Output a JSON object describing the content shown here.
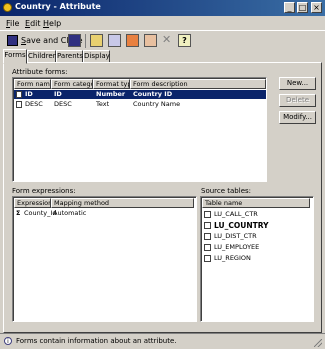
{
  "window": {
    "title": "Country - Attribute",
    "controls": [
      "_",
      "□",
      "×"
    ]
  },
  "menu": [
    {
      "label": "File",
      "underline": "F",
      "rest": "ile"
    },
    {
      "label": "Edit",
      "underline": "E",
      "rest": "dit"
    },
    {
      "label": "Help",
      "underline": "H",
      "rest": "elp"
    }
  ],
  "toolbar": {
    "save_close_u": "S",
    "save_close_rest": "ave and Close"
  },
  "tabs": [
    "Forms",
    "Children",
    "Parents",
    "Display"
  ],
  "attribute_forms": {
    "label": "Attribute forms:",
    "columns": [
      "Form name",
      "Form category",
      "Format type",
      "Form description"
    ],
    "rows": [
      {
        "name": "ID",
        "category": "ID",
        "format": "Number",
        "description": "Country ID"
      },
      {
        "name": "DESC",
        "category": "DESC",
        "format": "Text",
        "description": "Country Name"
      }
    ]
  },
  "buttons": {
    "new": "New...",
    "delete": "Delete",
    "modify": "Modify..."
  },
  "form_expressions": {
    "label": "Form expressions:",
    "columns": [
      "Expression",
      "Mapping method"
    ],
    "rows": [
      {
        "expression": "County_Id",
        "mapping": "Automatic"
      }
    ]
  },
  "source_tables": {
    "label": "Source tables:",
    "column": "Table name",
    "rows": [
      "LU_CALL_CTR",
      "LU_COUNTRY",
      "LU_DIST_CTR",
      "LU_EMPLOYEE",
      "LU_REGION"
    ]
  },
  "status": {
    "text": "Forms contain information about an attribute."
  },
  "colors": {
    "title_bar": "#0a246a",
    "selection": "#0a246a",
    "face": "#d4d0c8"
  },
  "icons": {
    "sigma": "Σ",
    "help": "?"
  }
}
